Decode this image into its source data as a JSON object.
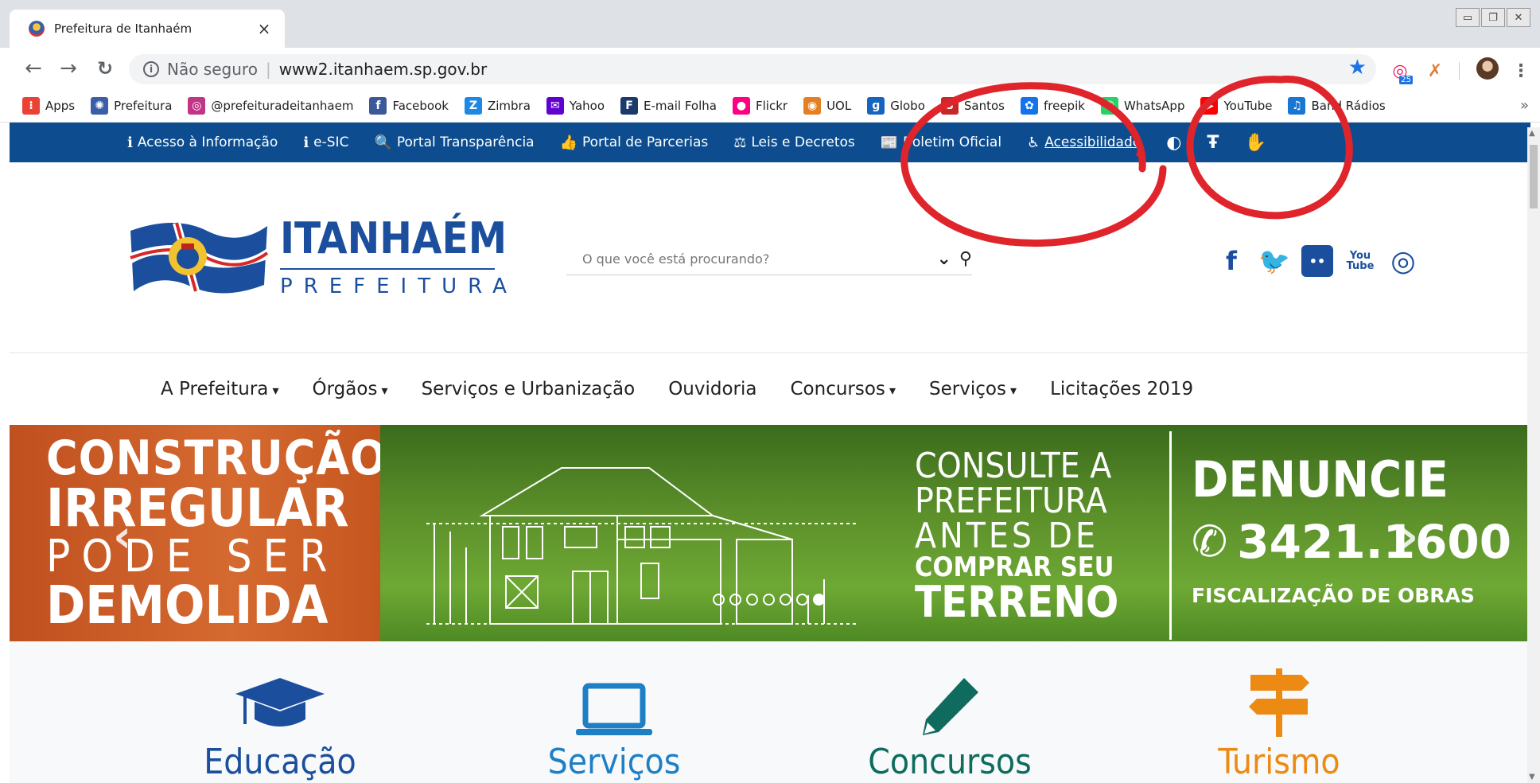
{
  "browser": {
    "tab_title": "Prefeitura de Itanhaém",
    "tab_close": "×",
    "security_label": "Não seguro",
    "url": "www2.itanhaem.sp.gov.br",
    "ext_badge": "25",
    "bookmarks": [
      {
        "label": "Apps",
        "icon": "apps-grid-icon",
        "color": "#ea4335"
      },
      {
        "label": "Prefeitura",
        "icon": "prefeitura-icon",
        "color": "#3b5ea8"
      },
      {
        "label": "@prefeituradeitanhaem",
        "icon": "instagram-icon",
        "color": "#c13584"
      },
      {
        "label": "Facebook",
        "icon": "facebook-icon",
        "color": "#3b5998"
      },
      {
        "label": "Zimbra",
        "icon": "zimbra-icon",
        "color": "#1e88e5"
      },
      {
        "label": "Yahoo",
        "icon": "yahoo-mail-icon",
        "color": "#6001d2"
      },
      {
        "label": "E-mail Folha",
        "icon": "folha-icon",
        "color": "#1a3a6b"
      },
      {
        "label": "Flickr",
        "icon": "flickr-icon",
        "color": "#ff0084"
      },
      {
        "label": "UOL",
        "icon": "uol-icon",
        "color": "#e67e22"
      },
      {
        "label": "Globo",
        "icon": "globo-icon",
        "color": "#1565c0"
      },
      {
        "label": "Santos",
        "icon": "santos-icon",
        "color": "#c62828"
      },
      {
        "label": "freepik",
        "icon": "freepik-icon",
        "color": "#1273eb"
      },
      {
        "label": "WhatsApp",
        "icon": "whatsapp-icon",
        "color": "#25d366"
      },
      {
        "label": "YouTube",
        "icon": "youtube-icon",
        "color": "#ff0000"
      },
      {
        "label": "Band Rádios",
        "icon": "band-radios-icon",
        "color": "#1976d2"
      }
    ],
    "more": "»"
  },
  "site": {
    "topbar": [
      {
        "label": "Acesso à Informação",
        "icon": "info-icon",
        "glyph": "ℹ"
      },
      {
        "label": "e-SIC",
        "icon": "esic-icon",
        "glyph": "ℹ"
      },
      {
        "label": "Portal Transparência",
        "icon": "search-icon",
        "glyph": "🔍"
      },
      {
        "label": "Portal de Parcerias",
        "icon": "thumbs-up-icon",
        "glyph": "👍"
      },
      {
        "label": "Leis e Decretos",
        "icon": "gavel-icon",
        "glyph": "⚖"
      },
      {
        "label": "Boletim Oficial",
        "icon": "newspaper-icon",
        "glyph": "📰"
      },
      {
        "label": "Acessibilidade",
        "icon": "accessibility-icon",
        "glyph": "♿"
      }
    ],
    "contrast_glyph": "◐",
    "font_glyph": "Ŧ",
    "sign_glyph": "✋",
    "logo_title": "ITANHAÉM",
    "logo_subtitle": "PREFEITURA",
    "search_placeholder": "O que você está procurando?",
    "social": [
      {
        "icon": "facebook-icon",
        "glyph": "f"
      },
      {
        "icon": "twitter-icon",
        "glyph": "🐦"
      },
      {
        "icon": "flickr-icon",
        "glyph": "••"
      },
      {
        "icon": "youtube-icon",
        "glyph": "You\nTube"
      },
      {
        "icon": "instagram-icon",
        "glyph": "◎"
      }
    ],
    "nav": [
      {
        "label": "A Prefeitura",
        "dropdown": true
      },
      {
        "label": "Órgãos",
        "dropdown": true
      },
      {
        "label": "Serviços e Urbanização",
        "dropdown": false
      },
      {
        "label": "Ouvidoria",
        "dropdown": false
      },
      {
        "label": "Concursos",
        "dropdown": true
      },
      {
        "label": "Serviços",
        "dropdown": true
      },
      {
        "label": "Licitações 2019",
        "dropdown": false
      }
    ],
    "banner": {
      "left_lines": [
        "CONSTRUÇÃO",
        "IRREGULAR",
        "PODE SER",
        "DEMOLIDA"
      ],
      "mid_lines": [
        "CONSULTE A",
        "PREFEITURA",
        "ANTES DE",
        "COMPRAR SEU",
        "TERRENO"
      ],
      "right_title": "DENUNCIE",
      "right_phone": "3421.1600",
      "right_footer": "FISCALIZAÇÃO DE OBRAS",
      "prev": "‹",
      "next": "›",
      "slides_total": 7,
      "active_slide": 7
    },
    "categories": [
      {
        "label": "Educação",
        "icon": "graduation-cap-icon",
        "color": "#1b4f9e"
      },
      {
        "label": "Serviços",
        "icon": "laptop-icon",
        "color": "#1f7fc5"
      },
      {
        "label": "Concursos",
        "icon": "pencil-icon",
        "color": "#0e6b5e"
      },
      {
        "label": "Turismo",
        "icon": "signpost-icon",
        "color": "#ec8a13"
      }
    ]
  },
  "colors": {
    "topbar": "#0d4d8f",
    "brand": "#1b4f9e",
    "annotation": "#e0242b"
  }
}
